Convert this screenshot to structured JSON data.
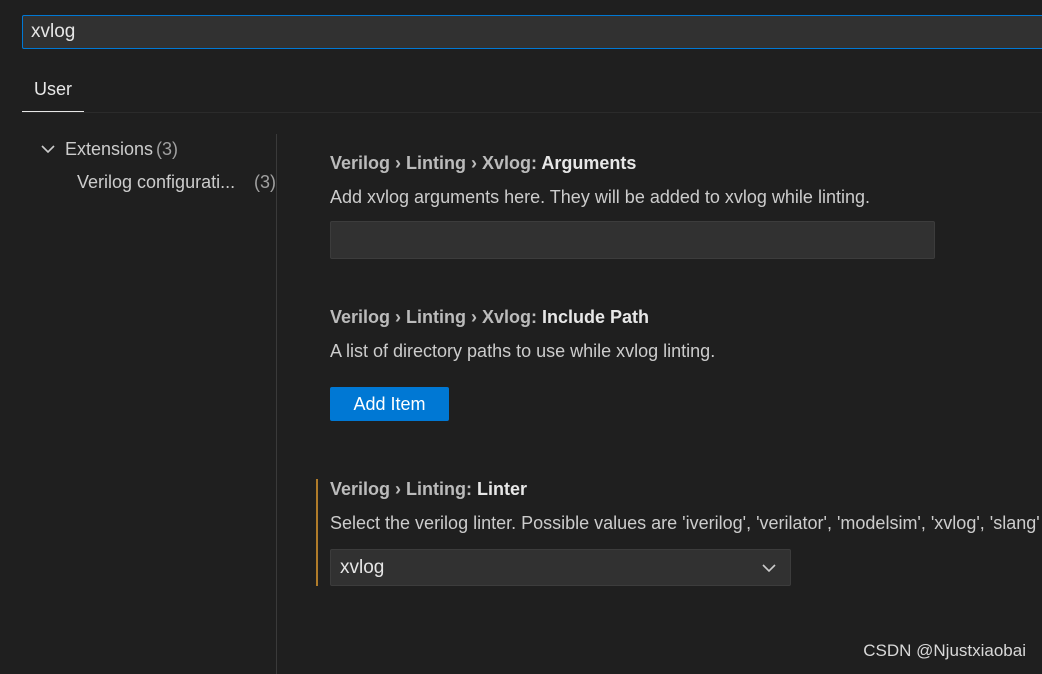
{
  "search": {
    "value": "xvlog"
  },
  "tabs": [
    {
      "label": "User"
    }
  ],
  "toc": {
    "group": {
      "label": "Extensions",
      "count": "(3)"
    },
    "item": {
      "label": "Verilog configurati...",
      "count": "(3)"
    }
  },
  "settings": [
    {
      "breadcrumb": "Verilog › Linting › Xvlog: ",
      "name": "Arguments",
      "description": "Add xvlog arguments here. They will be added to xvlog while linting.",
      "input_value": ""
    },
    {
      "breadcrumb": "Verilog › Linting › Xvlog: ",
      "name": "Include Path",
      "description": "A list of directory paths to use while xvlog linting.",
      "button_label": "Add Item"
    },
    {
      "breadcrumb": "Verilog › Linting: ",
      "name": "Linter",
      "description": "Select the verilog linter. Possible values are 'iverilog', 'verilator', 'modelsim', 'xvlog', 'slang'",
      "selected": "xvlog"
    }
  ],
  "watermark": "CSDN @Njustxiaobai",
  "colors": {
    "accent": "#0078d4",
    "modified_indicator": "#b07c2a",
    "background": "#1f1f1f"
  },
  "icons": {
    "toc_group": "chevron-down-icon",
    "select": "chevron-down-icon"
  }
}
